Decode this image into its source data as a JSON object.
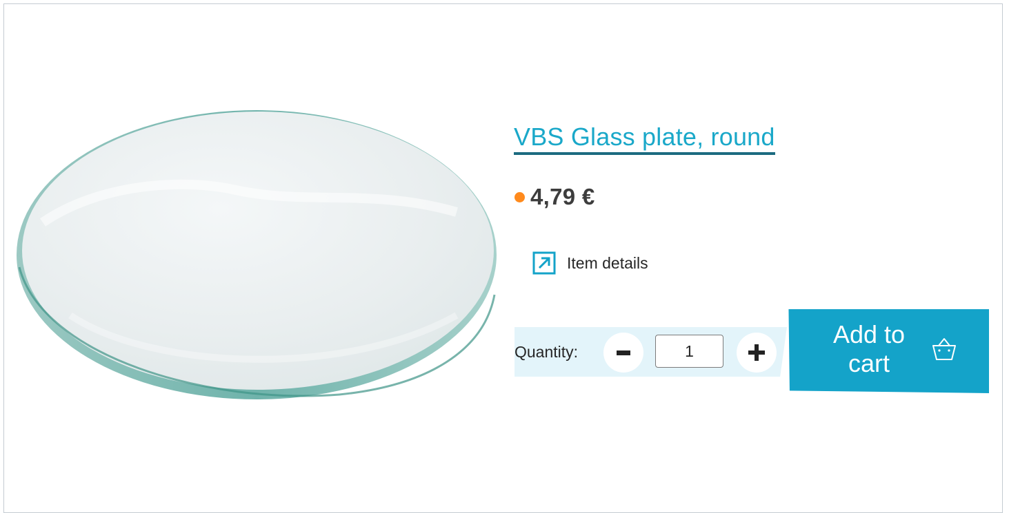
{
  "product": {
    "title": "VBS Glass plate, round",
    "price": "4,79 €",
    "availability_color": "#ff8a1c"
  },
  "details_link": {
    "label": "Item details",
    "icon": "external-arrow-icon"
  },
  "quantity": {
    "label": "Quantity:",
    "value": "1",
    "decrement_icon": "minus-icon",
    "increment_icon": "plus-icon"
  },
  "cart": {
    "label": "Add to cart",
    "icon": "basket-icon"
  },
  "colors": {
    "accent": "#14a3c9",
    "title_underline": "#1c6b80",
    "panel_bg": "#e3f4fa",
    "text": "#262626"
  }
}
